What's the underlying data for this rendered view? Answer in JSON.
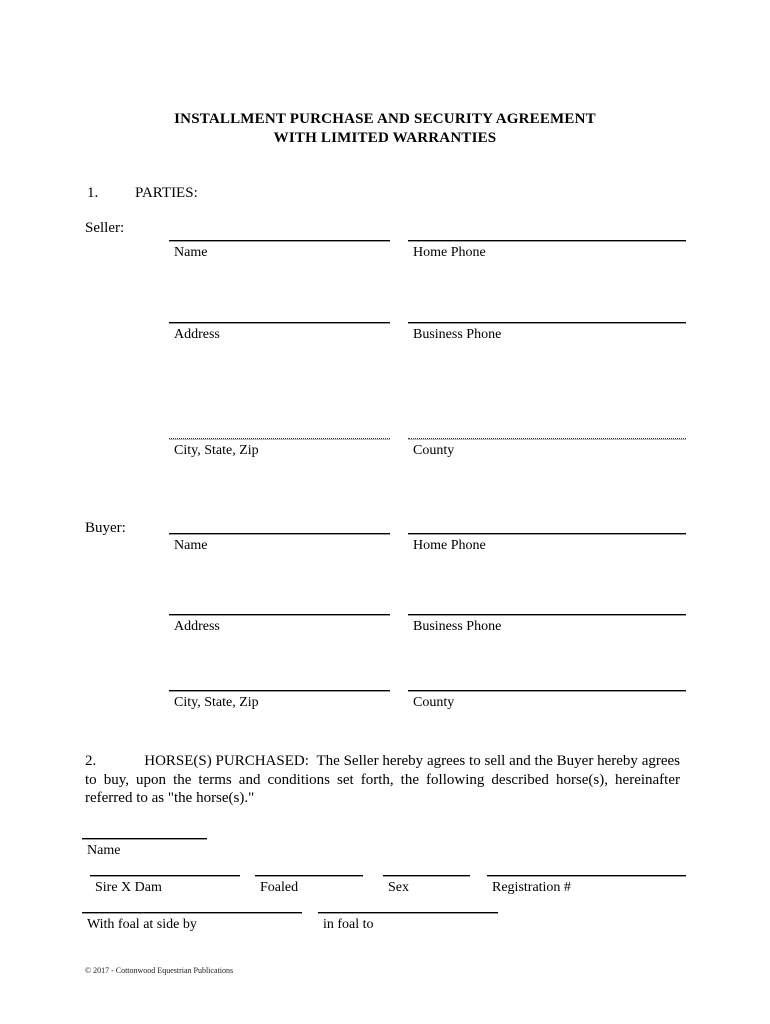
{
  "document": {
    "title_lines": [
      "INSTALLMENT PURCHASE AND SECURITY AGREEMENT",
      "WITH LIMITED WARRANTIES"
    ],
    "footer": "© 2017 - Cottonwood Equestrian Publications"
  },
  "clause1": {
    "number": "1.",
    "heading": "PARTIES:",
    "seller": {
      "label": "Seller:",
      "fields": [
        {
          "caption": "Name",
          "value": "",
          "column": "left",
          "style": "solid"
        },
        {
          "caption": "Home Phone",
          "value": "",
          "column": "right",
          "style": "solid"
        },
        {
          "caption": "Address",
          "value": "",
          "column": "left",
          "style": "solid"
        },
        {
          "caption": "Business Phone",
          "value": "",
          "column": "right",
          "style": "solid"
        },
        {
          "caption": "City, State, Zip",
          "value": "",
          "column": "left",
          "style": "dotted"
        },
        {
          "caption": "County",
          "value": "",
          "column": "right",
          "style": "dotted"
        }
      ]
    },
    "buyer": {
      "label": "Buyer:",
      "fields": [
        {
          "caption": "Name",
          "value": "",
          "column": "left",
          "style": "solid"
        },
        {
          "caption": "Home Phone",
          "value": "",
          "column": "right",
          "style": "solid"
        },
        {
          "caption": "Address",
          "value": "",
          "column": "left",
          "style": "solid"
        },
        {
          "caption": "Business Phone",
          "value": "",
          "column": "right",
          "style": "solid"
        },
        {
          "caption": "City, State, Zip",
          "value": "",
          "column": "left",
          "style": "solid"
        },
        {
          "caption": "County",
          "value": "",
          "column": "right",
          "style": "solid"
        }
      ]
    }
  },
  "clause2": {
    "number": "2.",
    "heading": "HORSE(S) PURCHASED:",
    "text": "The Seller hereby agrees to sell and the Buyer hereby agrees to buy, upon the terms and conditions set forth, the following described horse(s), hereinafter referred to as \"the horse(s).\"",
    "horse_fields": {
      "name": {
        "caption": "Name",
        "value": ""
      },
      "row1": [
        {
          "caption": "Sire X Dam",
          "value": ""
        },
        {
          "caption": "Foaled",
          "value": ""
        },
        {
          "caption": "Sex",
          "value": ""
        },
        {
          "caption": "Registration #",
          "value": ""
        }
      ],
      "row2": [
        {
          "caption": "With foal at side by",
          "value": ""
        },
        {
          "caption": "in foal to",
          "value": ""
        }
      ]
    }
  }
}
